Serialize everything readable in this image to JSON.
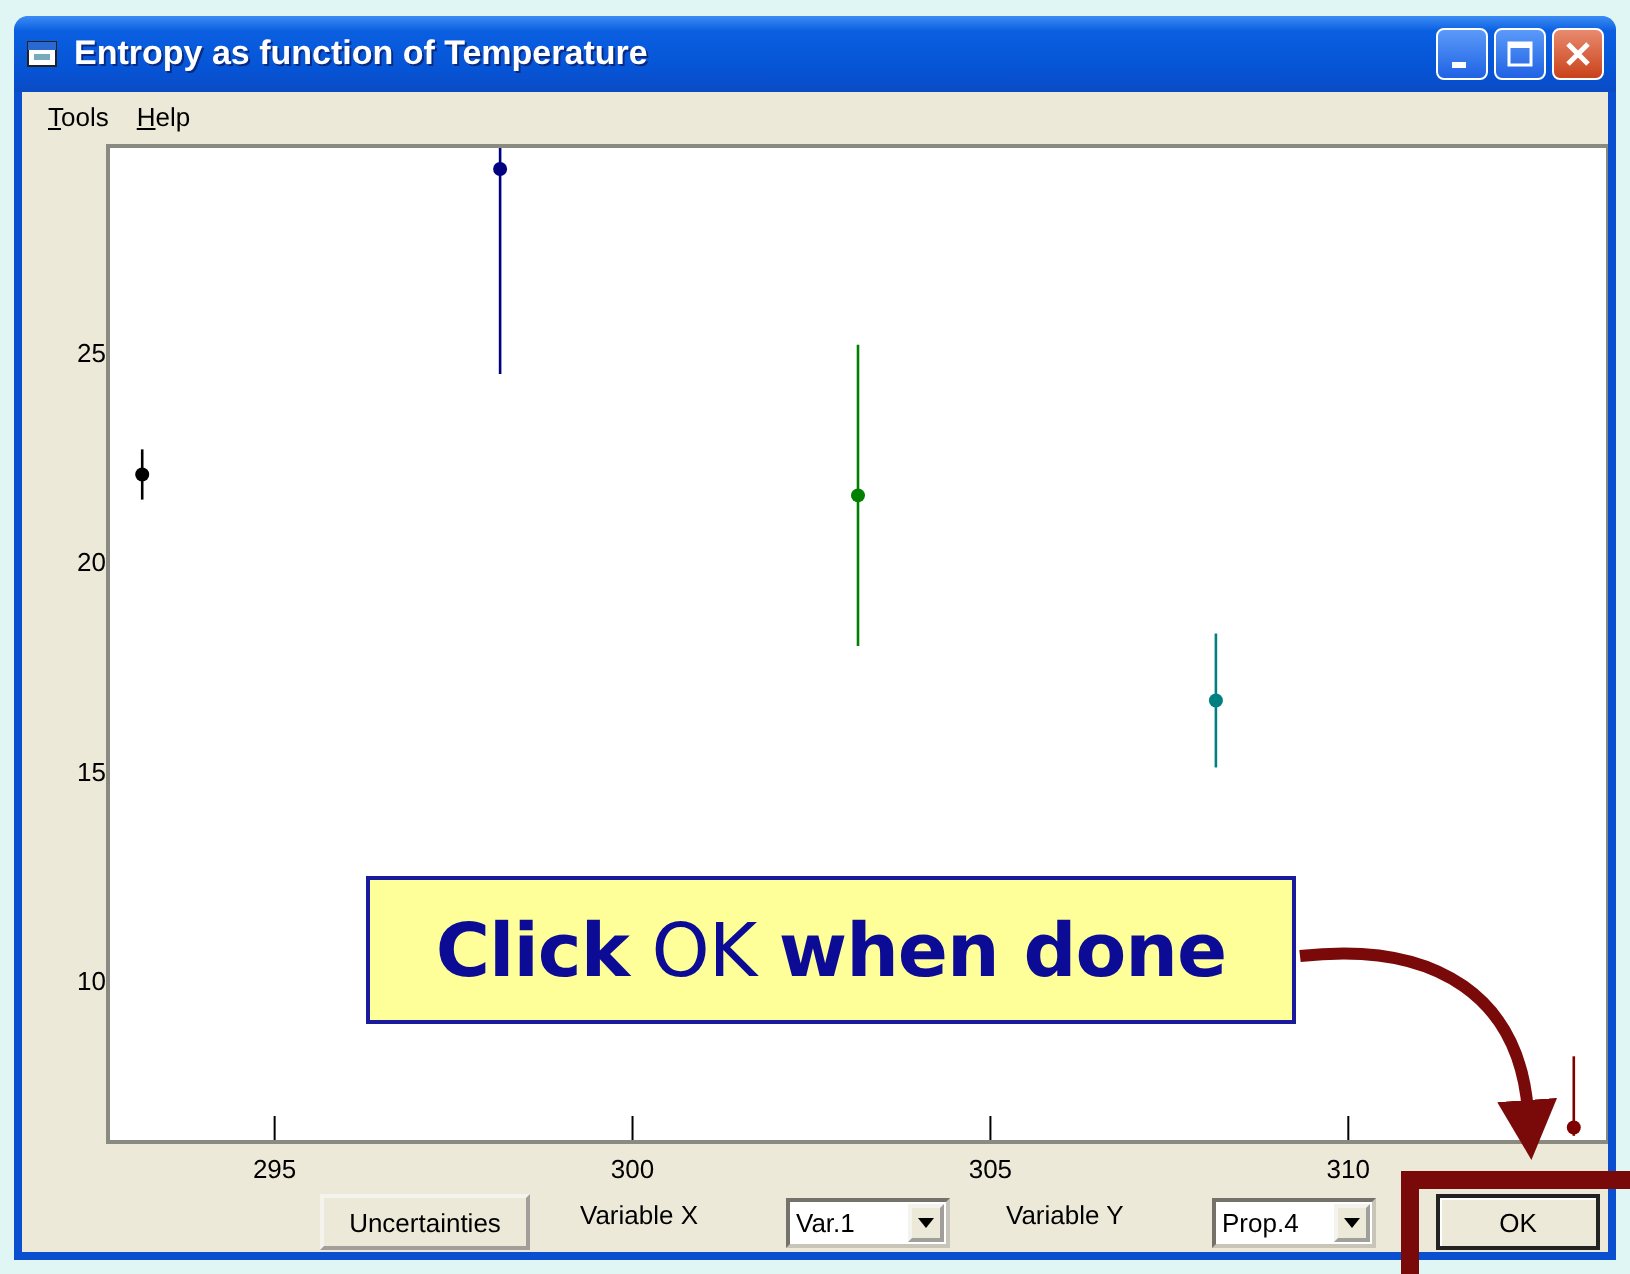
{
  "window": {
    "title": "Entropy as function of Temperature"
  },
  "menu": [
    {
      "label": "Tools"
    },
    {
      "label": "Help"
    }
  ],
  "plot": {
    "chart_data": {
      "type": "scatter",
      "x": [
        293.15,
        298.15,
        303.15,
        308.15,
        313.15
      ],
      "series": [
        {
          "color": "#000000",
          "values": [
            22.1,
            null,
            null,
            null,
            null
          ],
          "errors": [
            [
              21.5,
              22.7
            ],
            null,
            null,
            null,
            null
          ]
        },
        {
          "color": "#000080",
          "values": [
            null,
            29.4,
            null,
            null,
            null
          ],
          "errors": [
            null,
            [
              24.5,
              29.9
            ],
            null,
            null,
            null
          ]
        },
        {
          "color": "#008000",
          "values": [
            null,
            null,
            21.6,
            null,
            null
          ],
          "errors": [
            null,
            null,
            [
              18.0,
              25.2
            ],
            null,
            null
          ]
        },
        {
          "color": "#008080",
          "values": [
            null,
            null,
            null,
            16.7,
            null
          ],
          "errors": [
            null,
            null,
            null,
            [
              15.1,
              18.3
            ],
            null
          ]
        },
        {
          "color": "#800000",
          "values": [
            null,
            null,
            null,
            null,
            6.5
          ],
          "errors": [
            null,
            null,
            null,
            null,
            [
              6.3,
              8.2
            ]
          ]
        }
      ],
      "xlim": [
        292.7,
        313.6
      ],
      "ylim": [
        6.2,
        29.9
      ],
      "xticks": [
        295,
        300,
        305,
        310
      ],
      "yticks": [
        10,
        15,
        20,
        25
      ]
    }
  },
  "controls": {
    "uncertainties_button": "Uncertainties",
    "variable_x": {
      "label": "Variable X",
      "value": "Var.1"
    },
    "variable_y": {
      "label": "Variable Y",
      "value": "Prop.4"
    },
    "ok_button": "OK"
  },
  "callout": {
    "text": "**Click** OK **when done**"
  }
}
